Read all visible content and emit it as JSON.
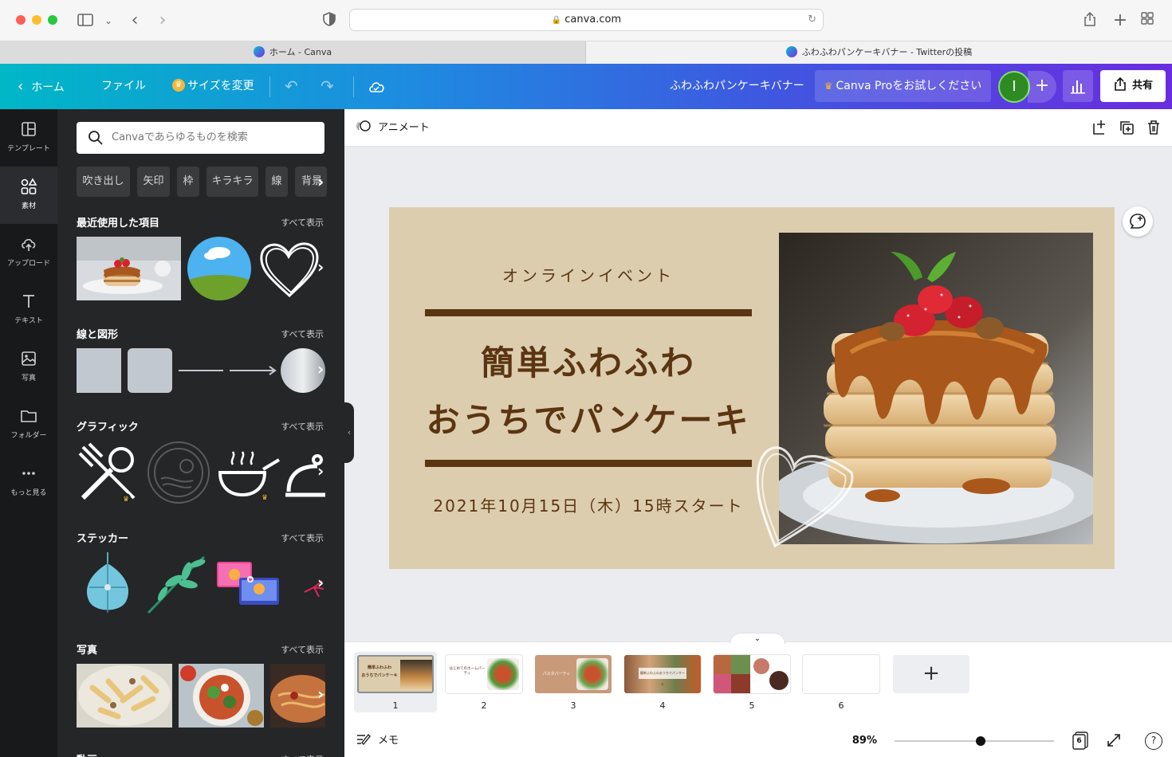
{
  "browser": {
    "url": "canva.com",
    "tabs": [
      {
        "label": "ホーム - Canva"
      },
      {
        "label": "ふわふわパンケーキバナー - Twitterの投稿"
      }
    ]
  },
  "header": {
    "home": "ホーム",
    "file": "ファイル",
    "resize": "サイズを変更",
    "title": "ふわふわパンケーキバナー",
    "pro": "Canva Proをお試しください",
    "avatar_initial": "I",
    "share": "共有"
  },
  "rail": {
    "items": [
      {
        "label": "テンプレート"
      },
      {
        "label": "素材"
      },
      {
        "label": "アップロード"
      },
      {
        "label": "テキスト"
      },
      {
        "label": "写真"
      },
      {
        "label": "フォルダー"
      },
      {
        "label": "もっと見る"
      }
    ]
  },
  "panel": {
    "search_placeholder": "Canvaであらゆるものを検索",
    "chips": [
      "吹き出し",
      "矢印",
      "枠",
      "キラキラ",
      "線",
      "背景"
    ],
    "see_all": "すべて表示",
    "sections": {
      "recent": "最近使用した項目",
      "shapes": "線と図形",
      "graphics": "グラフィック",
      "stickers": "ステッカー",
      "photos": "写真",
      "videos": "動画"
    }
  },
  "toolbar": {
    "animate": "アニメート"
  },
  "design": {
    "event_label": "オンラインイベント",
    "title_line1": "簡単ふわふわ",
    "title_line2": "おうちでパンケーキ",
    "date": "2021年10月15日（木）15時スタート"
  },
  "pages": {
    "thumbs": [
      {
        "num": "1",
        "t1": "簡単ふわふわ",
        "t2": "おうちでパンケーキ"
      },
      {
        "num": "2",
        "t1": "はじめてのホームパーティ"
      },
      {
        "num": "3",
        "t1": "パスタパーティ"
      },
      {
        "num": "4",
        "t1": "簡単ふわふわおうちでパンケーキ"
      },
      {
        "num": "5"
      },
      {
        "num": "6"
      }
    ],
    "add": "+"
  },
  "footer": {
    "notes": "メモ",
    "zoom": "89%",
    "zoom_fraction": 0.54,
    "page_count": "6",
    "help": "?"
  },
  "colors": {
    "accent_brown": "#5b3512",
    "design_bg": "#dccdae",
    "rail_bg": "#18191b",
    "panel_bg": "#252627"
  }
}
